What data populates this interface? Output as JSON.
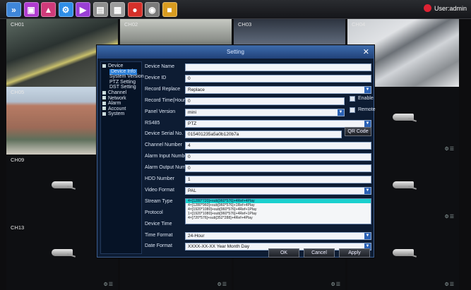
{
  "topbar": {
    "icons": [
      {
        "name": "menu-icon",
        "glyph": "»",
        "color": "#3f86d9"
      },
      {
        "name": "playback-icon",
        "glyph": "▣",
        "color": "#b03bd0"
      },
      {
        "name": "record-icon",
        "glyph": "▲",
        "color": "#d03a7a"
      },
      {
        "name": "settings-icon",
        "glyph": "⚙",
        "color": "#2f8ee8"
      },
      {
        "name": "play-icon",
        "glyph": "▶",
        "color": "#9a3fd6"
      },
      {
        "name": "backup-icon",
        "glyph": "▤",
        "color": "#8e8e8e"
      },
      {
        "name": "calendar-icon",
        "glyph": "▦",
        "color": "#9c9c9c"
      },
      {
        "name": "alarm-icon",
        "glyph": "●",
        "color": "#d6302a"
      },
      {
        "name": "disk-icon",
        "glyph": "◉",
        "color": "#7a7a7a"
      },
      {
        "name": "layout-icon",
        "glyph": "■",
        "color": "#d99c20"
      }
    ],
    "user": "User:admin"
  },
  "cells": [
    {
      "label": "CH01",
      "kind": "parking"
    },
    {
      "label": "CH02",
      "kind": "tunnel"
    },
    {
      "label": "CH03",
      "kind": "crowd"
    },
    {
      "label": "CH04",
      "kind": "lot"
    },
    {
      "label": "CH05",
      "kind": "building"
    },
    {
      "label": "",
      "kind": "dark"
    },
    {
      "label": "",
      "kind": "dark"
    },
    {
      "label": "",
      "kind": "dark"
    },
    {
      "label": "CH09",
      "kind": "dark"
    },
    {
      "label": "",
      "kind": "dark"
    },
    {
      "label": "",
      "kind": "dark"
    },
    {
      "label": "",
      "kind": "dark"
    },
    {
      "label": "CH13",
      "kind": "dark"
    },
    {
      "label": "",
      "kind": "dark"
    },
    {
      "label": "",
      "kind": "dark"
    },
    {
      "label": "",
      "kind": "dark"
    }
  ],
  "camera_status": "⚙☰",
  "dialog": {
    "title": "Setting",
    "close": "✕",
    "tree": [
      {
        "label": "Device",
        "level": 0,
        "selected": false
      },
      {
        "label": "Device Info",
        "level": 1,
        "selected": true
      },
      {
        "label": "System Version",
        "level": 1,
        "selected": false
      },
      {
        "label": "PTZ Setting",
        "level": 1,
        "selected": false
      },
      {
        "label": "DST Setting",
        "level": 1,
        "selected": false
      },
      {
        "label": "Channel",
        "level": 0,
        "selected": false
      },
      {
        "label": "Network",
        "level": 0,
        "selected": false
      },
      {
        "label": "Alarm",
        "level": 0,
        "selected": false
      },
      {
        "label": "Account",
        "level": 0,
        "selected": false
      },
      {
        "label": "System",
        "level": 0,
        "selected": false
      }
    ],
    "fields": [
      {
        "label": "Device Name",
        "value": "",
        "type": "text"
      },
      {
        "label": "Device ID",
        "value": "0",
        "type": "text"
      },
      {
        "label": "Record Replace",
        "value": "Replace",
        "type": "select"
      },
      {
        "label": "Record Time(Hour)",
        "value": "0",
        "type": "text"
      },
      {
        "label": "Panel Version",
        "value": "mini",
        "type": "select"
      },
      {
        "label": "RS485",
        "value": "PTZ",
        "type": "select"
      },
      {
        "label": "Device Serial No.",
        "value": "015401235a5a0b120b7a",
        "type": "text"
      },
      {
        "label": "Channel Number",
        "value": "4",
        "type": "text"
      },
      {
        "label": "Alarm Input Number",
        "value": "0",
        "type": "text"
      },
      {
        "label": "Alarm Output Number",
        "value": "0",
        "type": "text"
      },
      {
        "label": "HDD Number",
        "value": "1",
        "type": "text"
      },
      {
        "label": "Video Format",
        "value": "PAL",
        "type": "select"
      },
      {
        "label": "Stream Type",
        "value": "4×[1280*720]+sub[960*576]+4Ref+4Play",
        "type": "select"
      },
      {
        "label": "Protocol",
        "value": "",
        "type": "none"
      },
      {
        "label": "Device Time",
        "value": "",
        "type": "none"
      },
      {
        "label": "Time Format",
        "value": "24-Hour",
        "type": "select"
      },
      {
        "label": "Date Format",
        "value": "XXXX-XX-XX Year Month Day",
        "type": "select"
      }
    ],
    "enable_label": "Enable",
    "remote_label": "Remote",
    "qr_button": "QR Code",
    "stream_options": [
      {
        "text": "4×[1280*720]+sub[960*576]+4Ref+4Play",
        "selected": true
      },
      {
        "text": "4×[1280*960]+sub[960*576]+1Ref+4Play",
        "selected": false
      },
      {
        "text": "4×[1920*1080]+sub[960*576]+4Ref+1Play",
        "selected": false
      },
      {
        "text": "1×[1920*1080]+sub[960*576]+4Ref+1Play",
        "selected": false
      },
      {
        "text": "4×[720*576]+sub[352*288]+4Ref+4Play",
        "selected": false
      }
    ],
    "ok": "OK",
    "cancel": "Cancel",
    "apply": "Apply"
  }
}
